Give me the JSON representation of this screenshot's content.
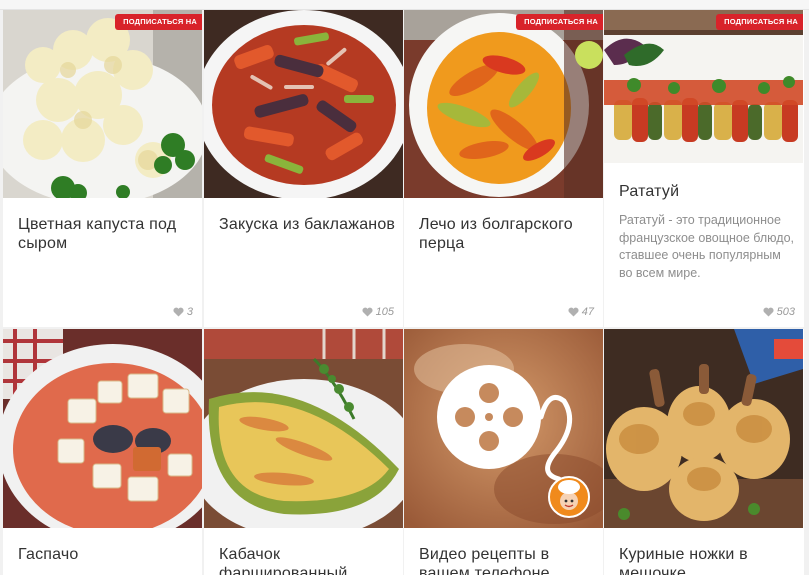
{
  "subscribe_badge": "ПОДПИСАТЬСЯ НА",
  "cards": [
    {
      "title": "Цветная капуста под сыром",
      "likes": "3",
      "badge": true
    },
    {
      "title": "Закуска из баклажанов",
      "likes": "105",
      "badge": false
    },
    {
      "title": "Лечо из болгарского перца",
      "likes": "47",
      "badge": true
    },
    {
      "title": "Рататуй",
      "description": "Рататуй - это традиционное французское овощное блюдо, ставшее очень популярным во всем мире.",
      "likes": "503",
      "badge": true
    },
    {
      "title": "Гаспачо"
    },
    {
      "title": "Кабачок фаршированный"
    },
    {
      "title": "Видео рецепты в вашем телефоне"
    },
    {
      "title": "Куриные ножки в мешочке"
    }
  ],
  "colors": {
    "badge": "#d8232a",
    "background": "#f1f1f1",
    "card": "#ffffff",
    "muted_text": "#8e8e8e"
  },
  "icons": [
    "heart-icon",
    "film-reel-icon",
    "chef-logo-icon"
  ]
}
